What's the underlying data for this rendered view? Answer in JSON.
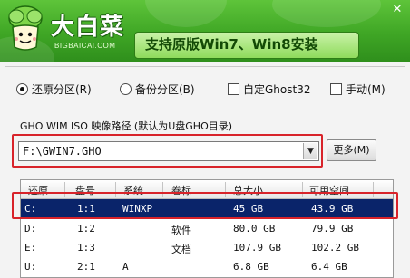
{
  "header": {
    "brand_name": "大白菜",
    "brand_domain": "BIGBAICAI.COM",
    "slogan": "支持原版Win7、Win8安装",
    "close_glyph": "✕",
    "colors": {
      "green_top": "#5ec43a",
      "green_bottom": "#2f8f1c",
      "highlight": "#d8232a"
    }
  },
  "options": {
    "restore": {
      "label": "还原分区(R)",
      "selected": true
    },
    "backup": {
      "label": "备份分区(B)",
      "selected": false
    },
    "custom_ghost": {
      "label": "自定Ghost32",
      "checked": false
    },
    "manual": {
      "label": "手动(M)",
      "checked": false
    }
  },
  "image_path": {
    "label": "GHO WIM ISO 映像路径 (默认为U盘GHO目录)",
    "value": "F:\\GWIN7.GHO",
    "more_button": "更多(M)"
  },
  "table": {
    "columns": [
      "还原",
      "盘号",
      "系统",
      "卷标",
      "总大小",
      "可用空间"
    ],
    "rows": [
      {
        "drive": "C:",
        "disk": "1:1",
        "system": "WINXP",
        "label": "",
        "total": "45 GB",
        "free": "43.9 GB",
        "selected": true
      },
      {
        "drive": "D:",
        "disk": "1:2",
        "system": "",
        "label": "软件",
        "total": "80.0 GB",
        "free": "79.9 GB",
        "selected": false
      },
      {
        "drive": "E:",
        "disk": "1:3",
        "system": "",
        "label": "文档",
        "total": "107.9 GB",
        "free": "102.2 GB",
        "selected": false
      },
      {
        "drive": "U:",
        "disk": "2:1",
        "system": "A",
        "label": "",
        "total": "6.8 GB",
        "free": "6.4 GB",
        "selected": false
      }
    ]
  }
}
